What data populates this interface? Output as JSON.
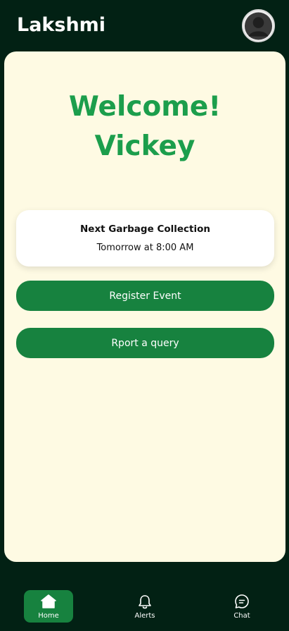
{
  "header": {
    "title": "Lakshmi"
  },
  "welcome": {
    "line1": "Welcome!",
    "line2": "Vickey"
  },
  "collection_card": {
    "title": "Next Garbage Collection",
    "time": "Tomorrow at 8:00 AM"
  },
  "actions": {
    "register_label": "Register Event",
    "report_label": "Rport a query"
  },
  "nav": {
    "home_label": "Home",
    "alerts_label": "Alerts",
    "chat_label": "Chat",
    "active": "Home"
  },
  "colors": {
    "background": "#022114",
    "panel": "#fefae3",
    "accent_green": "#17823f",
    "welcome_text": "#1c9e4c"
  },
  "icons": {
    "avatar": "user-avatar-icon",
    "home": "home-icon",
    "alerts": "bell-icon",
    "chat": "chat-bubble-icon"
  }
}
